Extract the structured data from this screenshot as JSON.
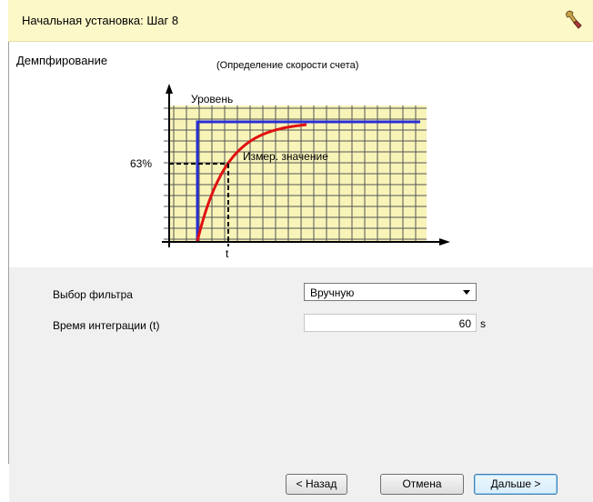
{
  "header": {
    "title": "Начальная установка: Шаг 8",
    "icon": "wrench-icon"
  },
  "section": {
    "title": "Демпфирование",
    "subtitle": "(Определение скорости счета)"
  },
  "diagram": {
    "level_label": "Уровень",
    "percent_label": "63%",
    "measured_label": "Измер. значение",
    "time_label": "t",
    "colors": {
      "level": "#2a2fd6",
      "curve": "#e01010",
      "grid_bg": "#f8f4b8"
    }
  },
  "form": {
    "filter_label": "Выбор фильтра",
    "filter_value": "Вручную",
    "time_label": "Время интеграции (t)",
    "time_value": "60",
    "time_unit": "s"
  },
  "footer": {
    "back": "< Назад",
    "cancel": "Отмена",
    "next": "Дальше >"
  }
}
